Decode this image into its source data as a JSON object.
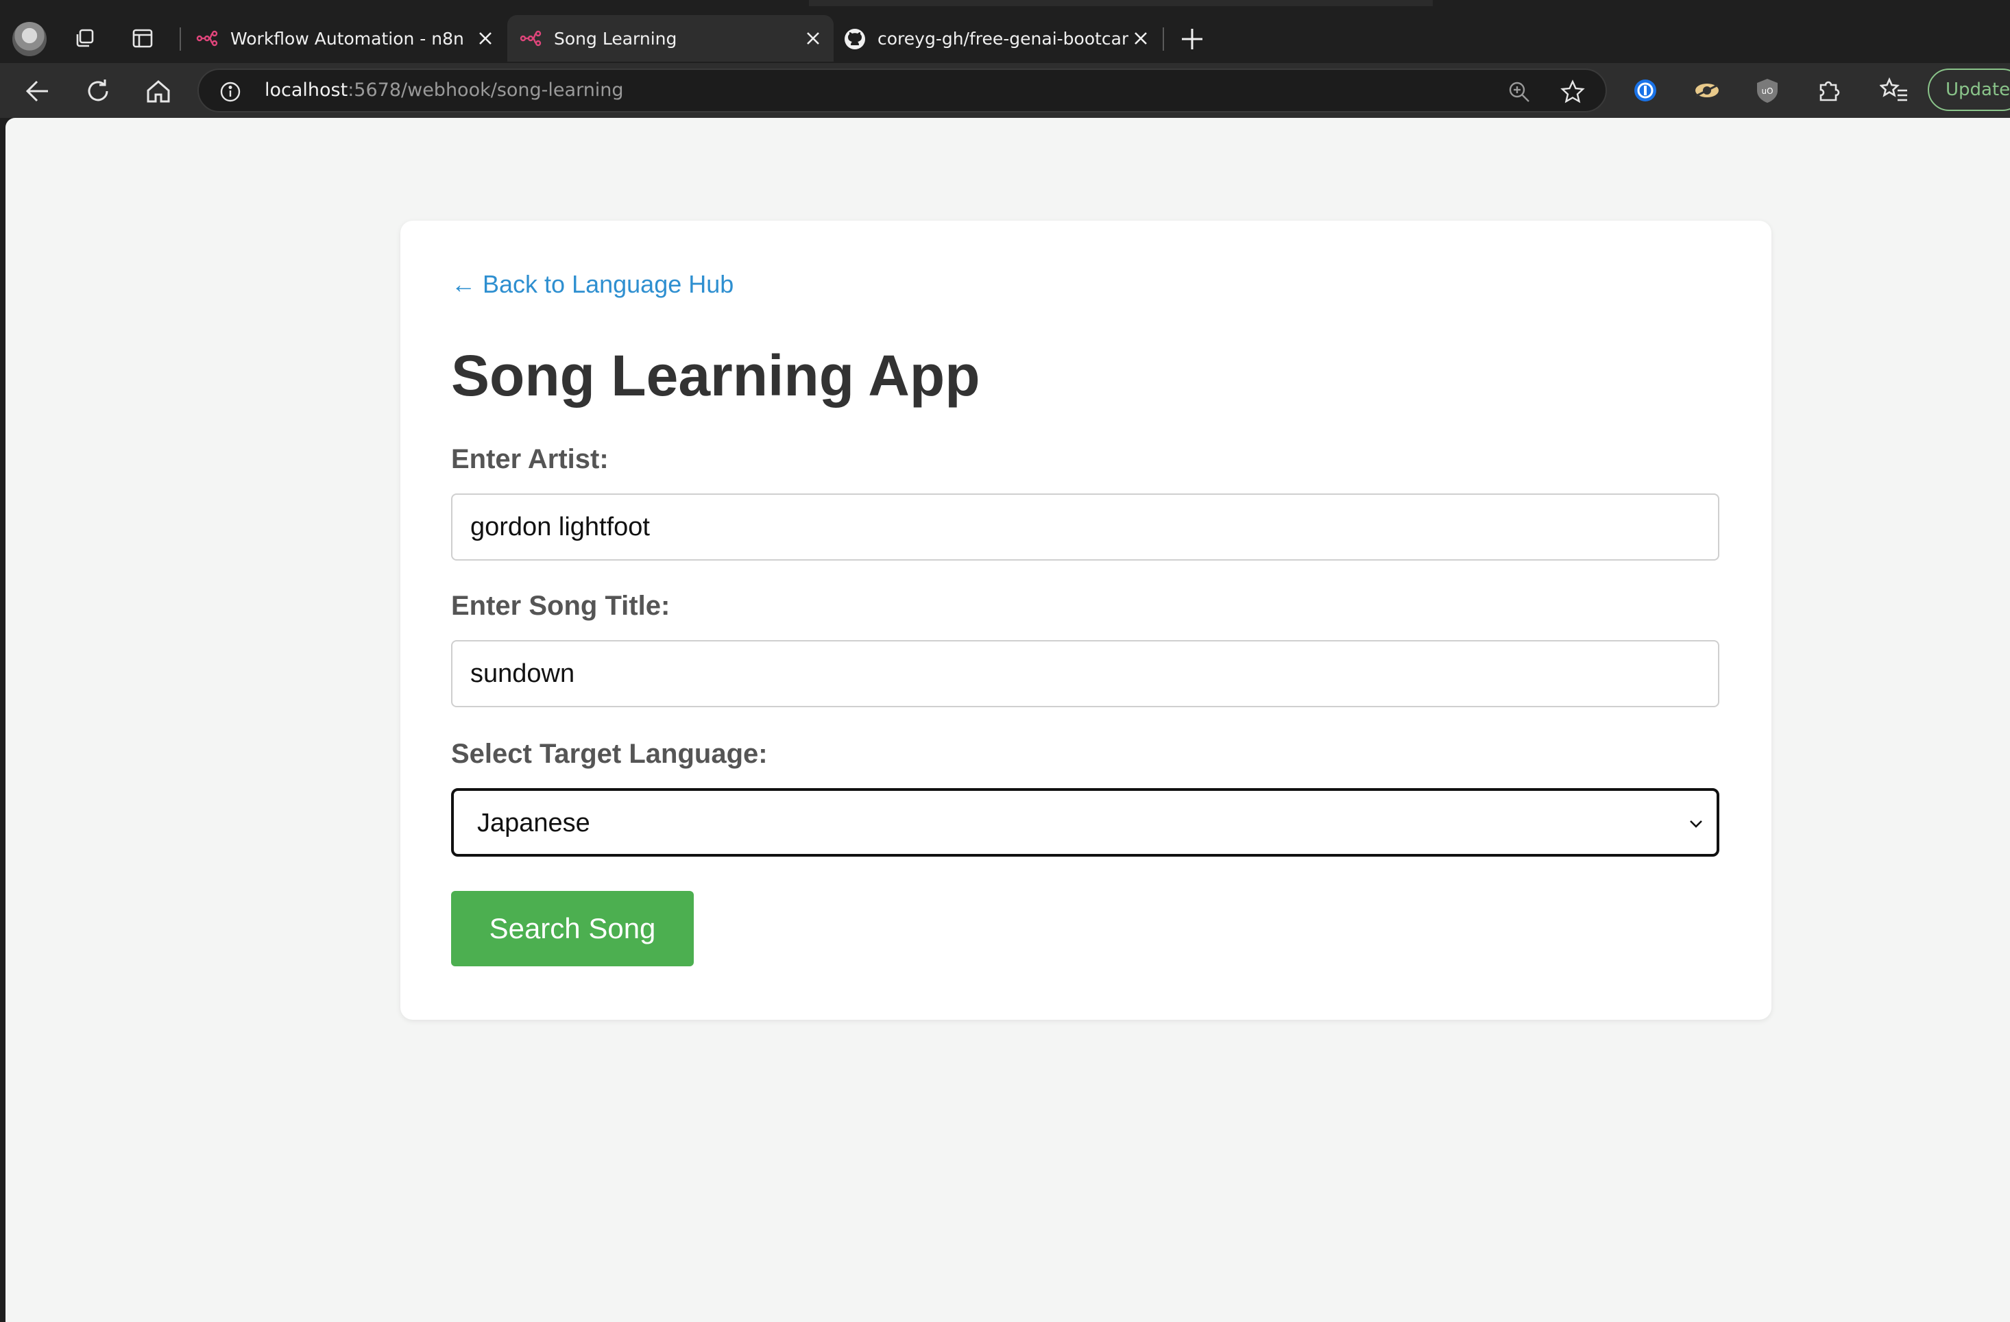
{
  "browser": {
    "tabs": [
      {
        "label": "Workflow Automation - n8n",
        "active": false
      },
      {
        "label": "Song Learning",
        "active": true
      },
      {
        "label": "coreyg-gh/free-genai-bootcamp-",
        "active": false
      }
    ],
    "url": {
      "host": "localhost",
      "rest": ":5678/webhook/song-learning"
    },
    "update_label": "Update"
  },
  "page": {
    "back_link": "← Back to Language Hub",
    "title": "Song Learning App",
    "artist": {
      "label": "Enter Artist:",
      "value": "gordon lightfoot"
    },
    "song": {
      "label": "Enter Song Title:",
      "value": "sundown"
    },
    "language": {
      "label": "Select Target Language:",
      "selected": "Japanese"
    },
    "search_button": "Search Song"
  },
  "colors": {
    "accent_link": "#2e8fd0",
    "button_green": "#4caf50",
    "update_green": "#8ac48a",
    "n8n_pink": "#e0457b"
  }
}
